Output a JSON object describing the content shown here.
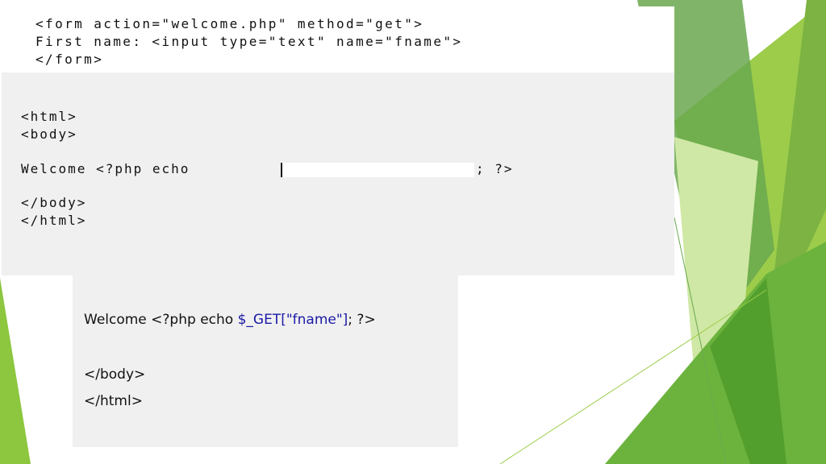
{
  "snippet_form": {
    "line1": "<form action=\"welcome.php\" method=\"get\">",
    "line2": "First name: <input type=\"text\" name=\"fname\">",
    "line3": "</form>"
  },
  "snippet_php": {
    "line1": "<html>",
    "line2": "<body>",
    "line3_prefix": "Welcome <?php echo ",
    "line3_suffix": "; ?>",
    "line4": "</body>",
    "line5": "</html>"
  },
  "snippet_answer": {
    "line1_prefix": "Welcome <?php echo ",
    "line1_var": "$_GET[\"fname\"]",
    "line1_suffix": "; ?>",
    "line2": "</body>",
    "line3": "</html>"
  },
  "colors": {
    "accent_green": "#8dc63f",
    "dark_green": "#4e9a2a",
    "code_variable": "#1a1aa6"
  }
}
